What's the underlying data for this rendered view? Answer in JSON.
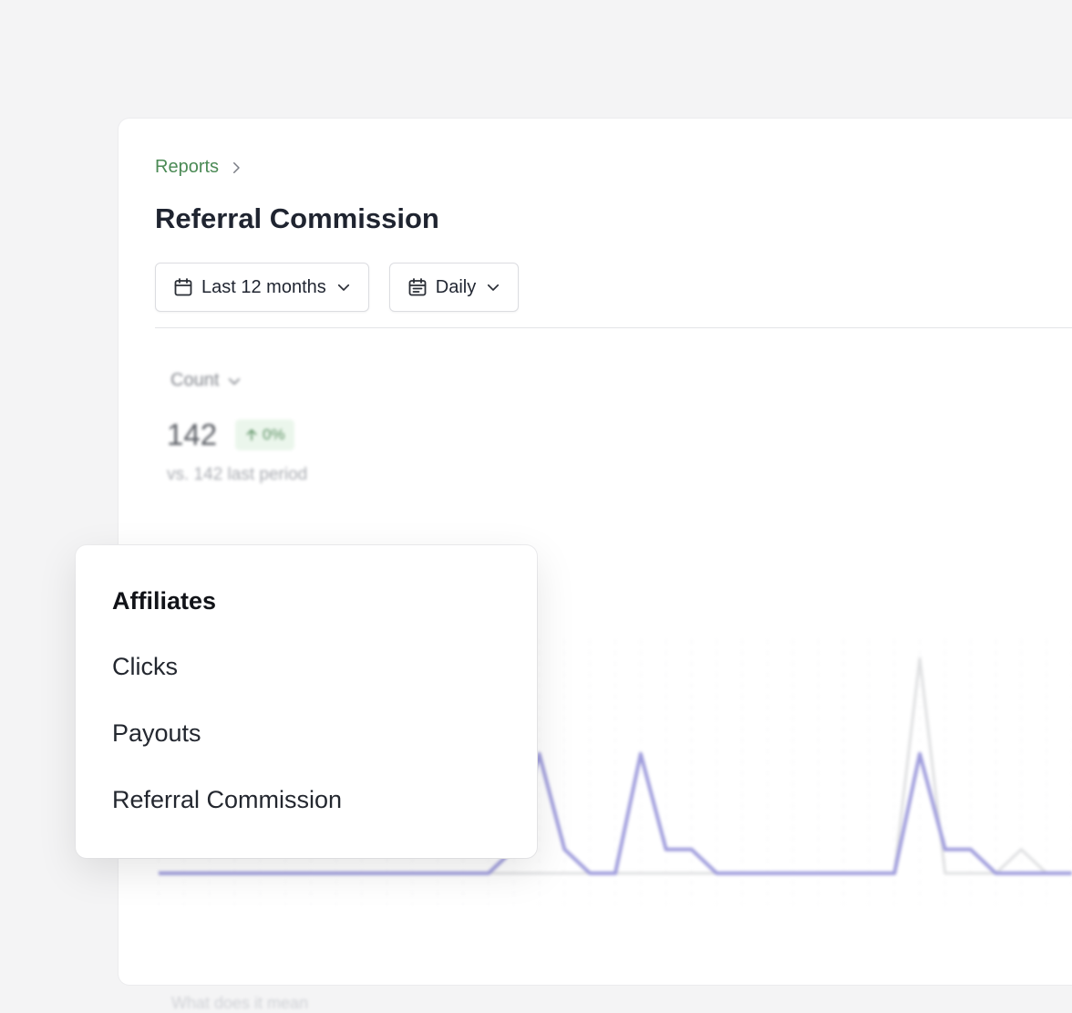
{
  "breadcrumb": {
    "label": "Reports"
  },
  "page": {
    "title": "Referral Commission"
  },
  "filters": {
    "range_label": "Last 12 months",
    "interval_label": "Daily"
  },
  "metric": {
    "selector_label": "Count",
    "value": "142",
    "change": "0%",
    "comparison": "vs. 142 last period"
  },
  "chart_data": {
    "type": "line",
    "title": "",
    "xlabel": "",
    "ylabel": "",
    "x": [
      1,
      2,
      3,
      4,
      5,
      6,
      7,
      8,
      9,
      10,
      11,
      12,
      13,
      14,
      15,
      16,
      17,
      18,
      19,
      20,
      21,
      22,
      23,
      24,
      25,
      26,
      27,
      28,
      29,
      30,
      31,
      32,
      33,
      34,
      35,
      36,
      37
    ],
    "series": [
      {
        "values": [
          1,
          1,
          1,
          1,
          1,
          1,
          1,
          1,
          1,
          1,
          1,
          1,
          1,
          1,
          2,
          6,
          2,
          1,
          1,
          6,
          2,
          2,
          1,
          1,
          1,
          1,
          1,
          1,
          1,
          1,
          6,
          2,
          2,
          1,
          1,
          1,
          1
        ]
      },
      {
        "values": [
          1,
          1,
          1,
          1,
          1,
          1,
          1,
          1,
          1,
          1,
          1,
          1,
          1,
          1,
          1,
          1,
          1,
          1,
          1,
          1,
          1,
          1,
          1,
          1,
          1,
          1,
          1,
          1,
          1,
          1,
          10,
          1,
          1,
          1,
          2,
          1,
          1
        ]
      }
    ],
    "grid": true,
    "legend": "none",
    "colors": [
      "#8e8bd6",
      "#d9dadc"
    ]
  },
  "chart_footer": "What does it mean",
  "menu": {
    "header": "Affiliates",
    "items": [
      "Clicks",
      "Payouts",
      "Referral Commission"
    ]
  },
  "colors": {
    "accent": "#4b8a55",
    "badge_bg": "#e8f5e9",
    "series": "#8e8bd6"
  }
}
